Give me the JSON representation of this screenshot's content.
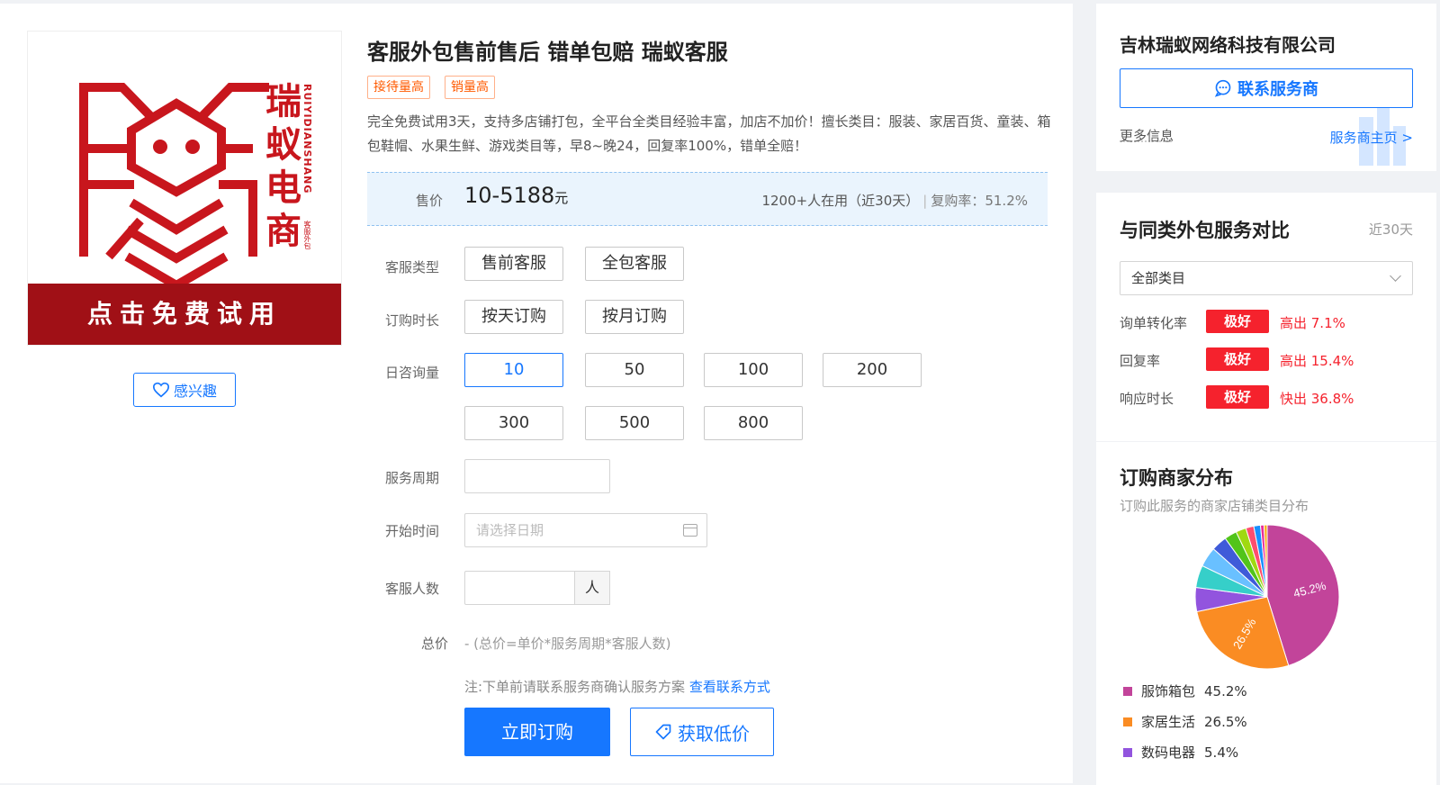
{
  "product": {
    "brand_chars": [
      "瑞",
      "蚁",
      "电",
      "商"
    ],
    "brand_pinyin": "RUIYIDIANSHANG",
    "brand_sub": "客服外包",
    "banner": "点击免费试用",
    "interest_label": "感兴趣",
    "title": "客服外包售前售后 错单包赔 瑞蚁客服",
    "tags": [
      "接待量高",
      "销量高"
    ],
    "description": "完全免费试用3天，支持多店铺打包，全平台全类目经验丰富，加店不加价！擅长类目：服装、家居百货、童装、箱包鞋帽、水果生鲜、游戏类目等，早8~晚24，回复率100%，错单全赔！"
  },
  "price": {
    "label": "售价",
    "value": "10-5188",
    "unit": "元",
    "users": "1200+人在用（近30天）",
    "repurchase": "复购率：51.2%"
  },
  "options": {
    "service_type": {
      "label": "客服类型",
      "items": [
        "售前客服",
        "全包客服"
      ]
    },
    "duration": {
      "label": "订购时长",
      "items": [
        "按天订购",
        "按月订购"
      ]
    },
    "daily": {
      "label": "日咨询量",
      "items": [
        "10",
        "50",
        "100",
        "200",
        "300",
        "500",
        "800"
      ]
    }
  },
  "form": {
    "period_label": "服务周期",
    "start_label": "开始时间",
    "start_placeholder": "请选择日期",
    "staff_label": "客服人数",
    "staff_unit": "人",
    "total_label": "总价",
    "total_text": "- (总价=单价*服务周期*客服人数)",
    "note": "注:下单前请联系服务商确认服务方案",
    "note_link": "查看联系方式",
    "buy_label": "立即订购",
    "low_label": "获取低价"
  },
  "vendor": {
    "company": "吉林瑞蚁网络科技有限公司",
    "contact_label": "联系服务商",
    "more_info": "更多信息",
    "home_link": "服务商主页 >"
  },
  "compare": {
    "title": "与同类外包服务对比",
    "period": "近30天",
    "category": "全部类目",
    "metrics": [
      {
        "name": "询单转化率",
        "badge": "极好",
        "value": "高出 7.1%"
      },
      {
        "name": "回复率",
        "badge": "极好",
        "value": "高出 15.4%"
      },
      {
        "name": "响应时长",
        "badge": "极好",
        "value": "快出 36.8%"
      }
    ]
  },
  "distribution": {
    "title": "订购商家分布",
    "subtitle": "订购此服务的商家店铺类目分布",
    "legend": [
      {
        "name": "服饰箱包",
        "pct": "45.2%",
        "color": "#c2449a"
      },
      {
        "name": "家居生活",
        "pct": "26.5%",
        "color": "#fa8c23"
      },
      {
        "name": "数码电器",
        "pct": "5.4%",
        "color": "#9254de"
      }
    ],
    "slice_labels": [
      "45.2%",
      "26.5%"
    ]
  },
  "chart_data": {
    "type": "pie",
    "categories": [
      "服饰箱包",
      "家居生活",
      "数码电器"
    ],
    "values": [
      45.2,
      26.5,
      5.4,
      5.0,
      4.5,
      3.5,
      2.8,
      2.3,
      1.8,
      1.5,
      0.8,
      0.7
    ],
    "colors": [
      "#c2449a",
      "#fa8c23",
      "#9254de",
      "#36cfc9",
      "#69c0ff",
      "#3f5bd9",
      "#52c41a",
      "#a0d911",
      "#ff4d6d",
      "#1890ff",
      "#eb2f96",
      "#faad14"
    ],
    "labels_shown": [
      "45.2%",
      "26.5%"
    ]
  }
}
